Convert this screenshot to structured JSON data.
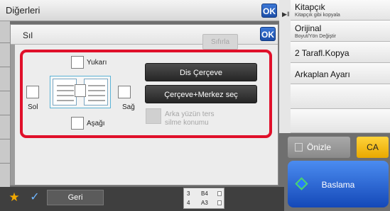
{
  "header": {
    "title": "Diğerleri",
    "ok_label": "OK"
  },
  "right_panel": {
    "items": [
      {
        "title": "Kitapçık",
        "subtitle": "Kitapçık gibi kopyala"
      },
      {
        "title": "Orijinal",
        "subtitle": "Boyut/Yön Değiştir"
      },
      {
        "title": "2 Tarafl.Kopya",
        "subtitle": ""
      },
      {
        "title": "Arkaplan Ayarı",
        "subtitle": ""
      },
      {
        "title": "",
        "subtitle": ""
      },
      {
        "title": "",
        "subtitle": ""
      }
    ],
    "onizle_label": "Önizle",
    "ca_label": "CA",
    "baslama_label": "Baslama"
  },
  "dialog": {
    "title": "Sıl",
    "sifirla_label": "Sıfırla",
    "ok_label": "OK",
    "options": {
      "top_label": "Yukarı",
      "left_label": "Sol",
      "right_label": "Sağ",
      "bottom_label": "Aşağı",
      "top_checked": false,
      "left_checked": false,
      "right_checked": false,
      "bottom_checked": false
    },
    "frame_button_label": "Dis Çerçeve",
    "frame_center_button_label": "Çerçeve+Merkez seç",
    "back_side_label_line1": "Arka yüzün ters",
    "back_side_label_line2": "silme konumu"
  },
  "bottom_bar": {
    "geri_label": "Geri",
    "trays": [
      {
        "number": "3",
        "size": "B4"
      },
      {
        "number": "4",
        "size": "A3"
      }
    ]
  },
  "colors": {
    "highlight": "#e0102a",
    "ok_button": "#1d4fa8",
    "ca_button": "#f2b800",
    "start_button": "#2b68d6",
    "star": "#f2a900"
  }
}
